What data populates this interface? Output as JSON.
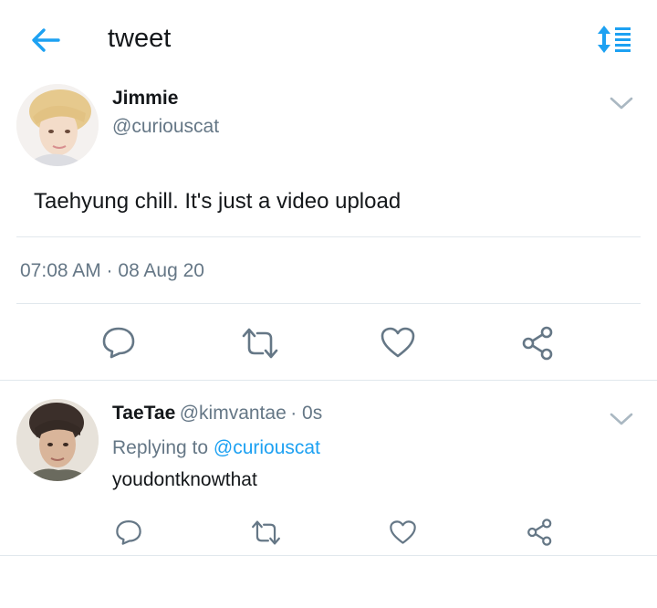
{
  "header": {
    "title": "tweet",
    "back_icon": "arrow-left-icon",
    "sort_icon": "sort-icon",
    "accent": "#1da1f2"
  },
  "tweet": {
    "name": "Jimmie",
    "handle": "@curiouscat",
    "text": "Taehyung chill. It's just a video upload",
    "timestamp": "07:08 AM · 08 Aug 20"
  },
  "reply": {
    "name": "TaeTae",
    "handle": "@kimvantae",
    "time": "· 0s",
    "replying_prefix": "Replying to",
    "replying_mention": "@curiouscat",
    "text": "youdontknowthat"
  },
  "actions": [
    "reply-icon",
    "retweet-icon",
    "like-icon",
    "share-icon"
  ]
}
